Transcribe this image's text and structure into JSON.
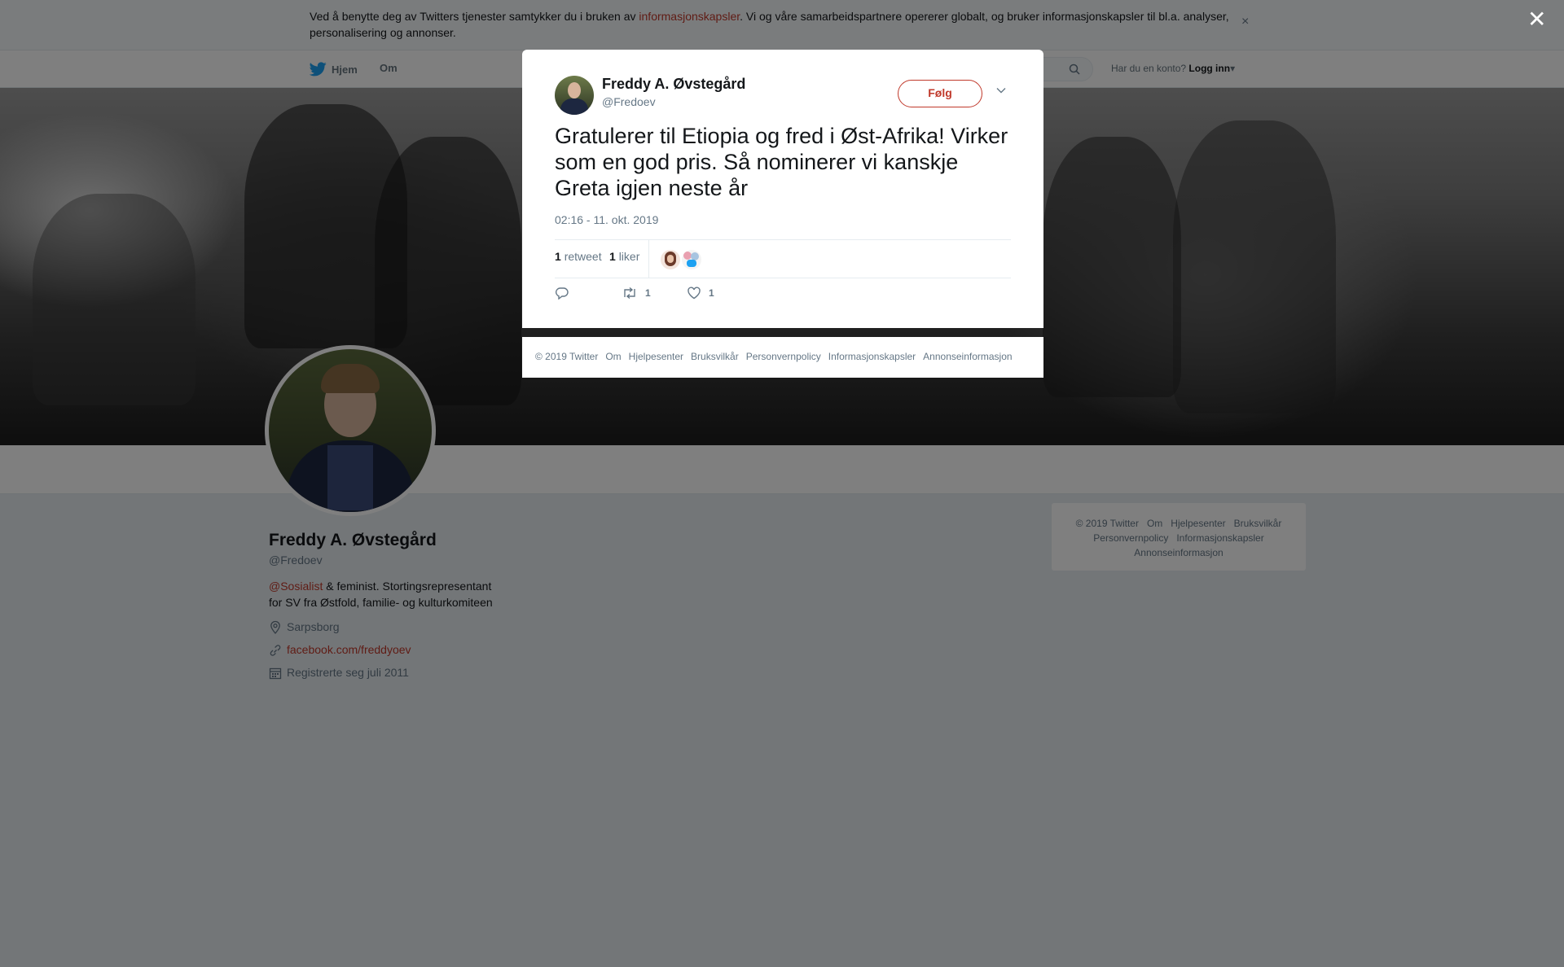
{
  "cookie_banner": {
    "text_before": "Ved å benytte deg av Twitters tjenester samtykker du i bruken av ",
    "link": "informasjonskapsler",
    "text_after": ". Vi og våre samarbeidspartnere opererer globalt, og bruker informasjonskapsler til bl.a. analyser, personalisering og annonser.",
    "close": "×"
  },
  "nav": {
    "home": "Hjem",
    "about": "Om",
    "login_prompt": "Har du en konto?",
    "login": "Logg inn",
    "login_caret": "▾"
  },
  "profile": {
    "name": "Freddy A. Øvstegård",
    "handle": "@Fredoev",
    "bio_mention": "@Sosialist",
    "bio_rest": " & feminist. Stortingsrepresentant for SV fra Østfold, familie- og kulturkomiteen",
    "location": "Sarpsborg",
    "website": "facebook.com/freddyoev",
    "joined": "Registrerte seg juli 2011"
  },
  "side_footer": {
    "items": [
      "© 2019 Twitter",
      "Om",
      "Hjelpesenter",
      "Bruksvilkår",
      "Personvernpolicy",
      "Informasjonskapsler",
      "Annonseinformasjon"
    ]
  },
  "overlay": {
    "close": "✕"
  },
  "tweet": {
    "author_name": "Freddy A. Øvstegård",
    "author_handle": "@Fredoev",
    "follow": "Følg",
    "text": "Gratulerer til Etiopia og fred i Øst-Afrika! Virker som en god pris. Så nominerer vi kanskje Greta igjen neste år",
    "timestamp": "02:16 - 11. okt. 2019",
    "retweet_count": "1",
    "retweet_label": "retweet",
    "like_count": "1",
    "like_label": "liker",
    "action_retweets": "1",
    "action_likes": "1"
  },
  "modal_footer": {
    "items": [
      "© 2019 Twitter",
      "Om",
      "Hjelpesenter",
      "Bruksvilkår",
      "Personvernpolicy",
      "Informasjonskapsler",
      "Annonseinformasjon"
    ]
  },
  "colors": {
    "link_accent": "#c0392b",
    "twitter_blue": "#1da1f2",
    "overlay": "rgba(0,0,0,0.5)"
  },
  "icons": [
    "twitter-bird-icon",
    "search-icon",
    "location-pin-icon",
    "link-icon",
    "calendar-icon",
    "chevron-down-icon",
    "reply-icon",
    "retweet-icon",
    "heart-icon",
    "close-icon"
  ]
}
